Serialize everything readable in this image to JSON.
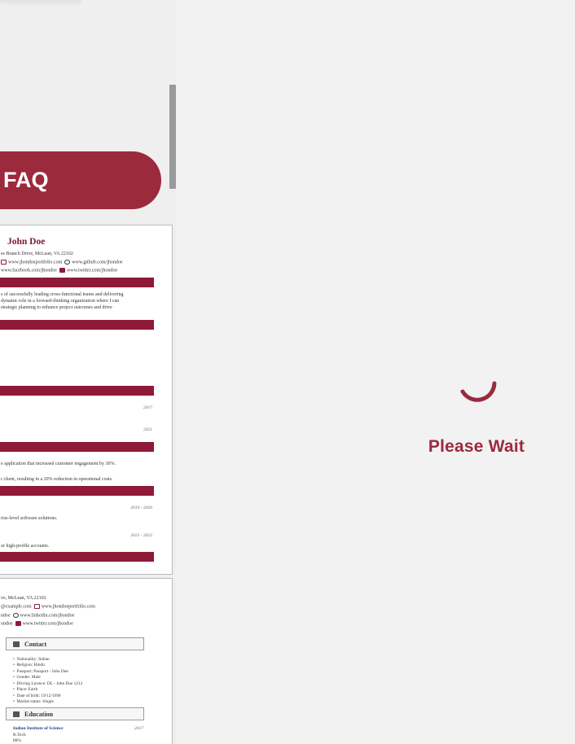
{
  "faq": {
    "label": "FAQ"
  },
  "loader": {
    "label": "Please Wait",
    "color": "#9b2a3d"
  },
  "resume_main": {
    "name": "John Doe",
    "address": "es Branch Drive, McLean, VA 22102",
    "links1": "www.jhondoeportfolio.com",
    "links1b": "www.github.com/jhondoe",
    "links2": "www.facebook.com/jhondoe",
    "links2b": "www.twitter.com/jhondoe",
    "summary": [
      "s of successfully leading cross-functional teams and delivering",
      "dynamic role in a forward-thinking organization where I can",
      "strategic planning to enhance project outcomes and drive"
    ],
    "date1": "2017",
    "date2": "2021",
    "achievement1": "e application that increased customer engagement by 30%.",
    "achievement2": "r client, resulting in a 20% reduction in operational costs.",
    "date3": "2019 - 2020",
    "work1": "rise-level software solutions.",
    "date4": "2021 - 2022",
    "work2": "or high-profile accounts."
  },
  "resume_alt": {
    "address": "ve, McLean, VA 22102",
    "links1": "@example.com",
    "links1b": "www.jhondoeportfolio.com",
    "links2": "ndoe",
    "links2b": "www.linkedin.com/jhondoe",
    "links3": "ondoe",
    "links3b": "www.twitter.com/jhondoe",
    "contact_title": "Contact",
    "contact_items": [
      "Nationality: Indian",
      "Religion: Hindu",
      "Passport: Passport - John Doe",
      "Gender: Male",
      "Driving Licence: DL - John Doe 1212",
      "Place: Earth",
      "Date of birth: 19/12/1990",
      "Marital status: Single"
    ],
    "education_title": "Education",
    "school": "Indian Institute of Science",
    "school_year": "2017",
    "degree": "B.Tech",
    "score": "88%"
  }
}
